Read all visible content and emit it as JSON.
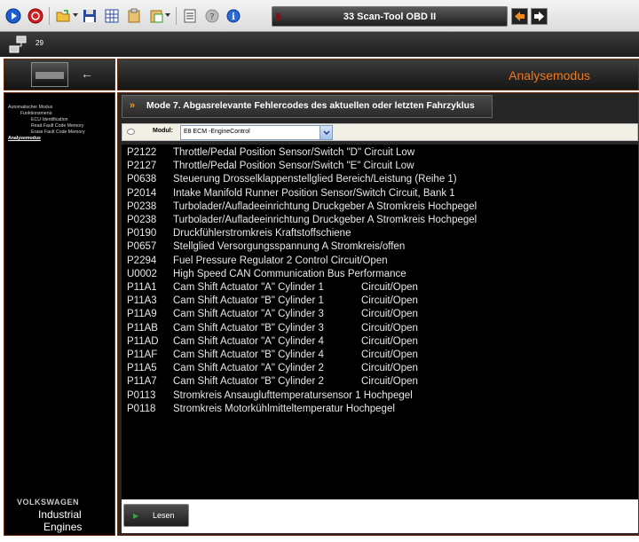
{
  "app": {
    "title": "33  Scan-Tool OBD II",
    "counter": "29",
    "mode_title": "Analysemodus"
  },
  "sidebar": {
    "items": [
      {
        "label": "Automatischer Modus",
        "active": false
      },
      {
        "label": "Funktionsmenü",
        "active": false
      },
      {
        "label": "ECU Identification",
        "active": false
      },
      {
        "label": "Read Fault Code Memory",
        "active": false
      },
      {
        "label": "Erase Fault Code Memory",
        "active": false
      },
      {
        "label": "Analysemodus",
        "active": true
      }
    ],
    "brand": "VOLKSWAGEN",
    "brand_line1": "Industrial",
    "brand_line2": "Engines"
  },
  "section": {
    "title": "Mode 7. Abgasrelevante Fehlercodes des aktuellen oder letzten Fahrzyklus"
  },
  "module": {
    "label": "Modul:",
    "selected": "E8  ECM -EngineControl"
  },
  "codes": [
    {
      "code": "P2122",
      "desc": "Throttle/Pedal Position Sensor/Switch \"D\" Circuit Low",
      "extra": ""
    },
    {
      "code": "P2127",
      "desc": "Throttle/Pedal Position Sensor/Switch \"E\" Circuit Low",
      "extra": ""
    },
    {
      "code": "P0638",
      "desc": "Steuerung Drosselklappenstellglied Bereich/Leistung (Reihe 1)",
      "extra": ""
    },
    {
      "code": "P2014",
      "desc": "Intake Manifold Runner Position Sensor/Switch Circuit, Bank 1",
      "extra": ""
    },
    {
      "code": "P0238",
      "desc": "Turbolader/Aufladeeinrichtung Druckgeber A Stromkreis Hochpegel",
      "extra": ""
    },
    {
      "code": "P0238",
      "desc": "Turbolader/Aufladeeinrichtung Druckgeber A Stromkreis Hochpegel",
      "extra": ""
    },
    {
      "code": "P0190",
      "desc": "Druckfühlerstromkreis Kraftstoffschiene",
      "extra": ""
    },
    {
      "code": "P0657",
      "desc": "Stellglied Versorgungsspannung A Stromkreis/offen",
      "extra": ""
    },
    {
      "code": "P2294",
      "desc": "Fuel Pressure Regulator 2 Control Circuit/Open",
      "extra": ""
    },
    {
      "code": "U0002",
      "desc": "High Speed CAN Communication Bus Performance",
      "extra": ""
    },
    {
      "code": "P11A1",
      "desc": "Cam Shift Actuator \"A\" Cylinder 1",
      "extra": "Circuit/Open"
    },
    {
      "code": "P11A3",
      "desc": "Cam Shift Actuator \"B\" Cylinder 1",
      "extra": "Circuit/Open"
    },
    {
      "code": "P11A9",
      "desc": "Cam Shift Actuator \"A\" Cylinder 3",
      "extra": "Circuit/Open"
    },
    {
      "code": "P11AB",
      "desc": "Cam Shift Actuator \"B\" Cylinder 3",
      "extra": "Circuit/Open"
    },
    {
      "code": "P11AD",
      "desc": "Cam Shift Actuator \"A\" Cylinder 4",
      "extra": "Circuit/Open"
    },
    {
      "code": "P11AF",
      "desc": "Cam Shift Actuator \"B\" Cylinder 4",
      "extra": "Circuit/Open"
    },
    {
      "code": "P11A5",
      "desc": "Cam Shift Actuator \"A\" Cylinder 2",
      "extra": "Circuit/Open"
    },
    {
      "code": "P11A7",
      "desc": "Cam Shift Actuator \"B\" Cylinder 2",
      "extra": "Circuit/Open"
    },
    {
      "code": "P0113",
      "desc": "Stromkreis Ansauglufttemperatursensor 1 Hochpegel",
      "extra": ""
    },
    {
      "code": "P0118",
      "desc": "Stromkreis Motorkühlmitteltemperatur Hochpegel",
      "extra": ""
    }
  ],
  "actions": {
    "read_label": "Lesen"
  },
  "colors": {
    "accent_orange": "#f0781e",
    "frame_brown": "#6a2a10",
    "list_bg": "#000000"
  }
}
